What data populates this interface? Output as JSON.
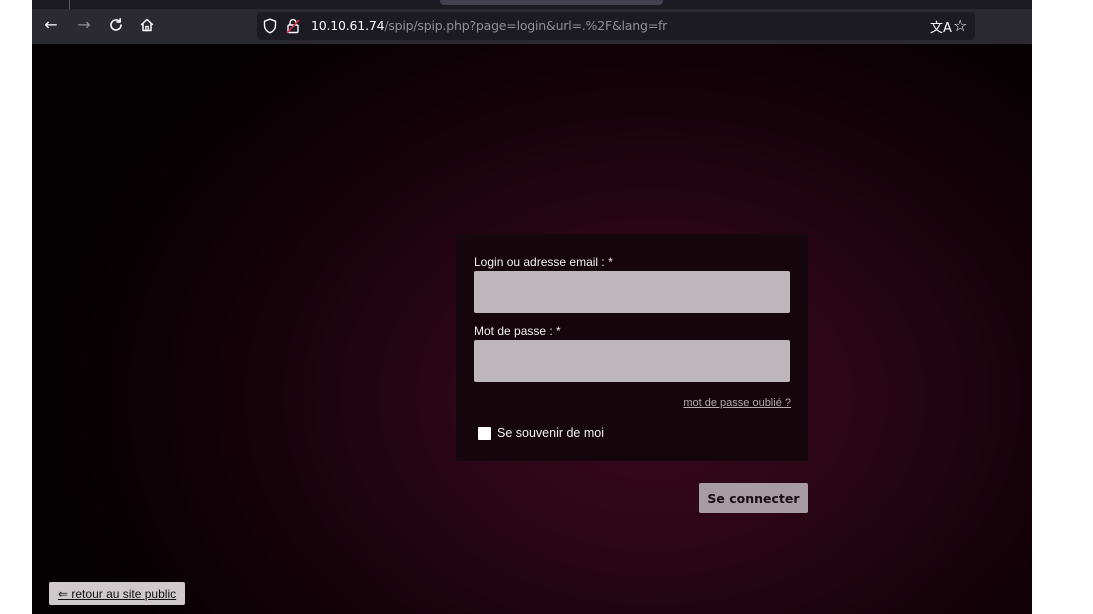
{
  "browser": {
    "back_icon": "←",
    "forward_icon": "→",
    "reload_icon": "C",
    "home_icon": "⌂",
    "url_host": "10.10.61.74",
    "url_path": "/spip/spip.php?page=login&url=.%2F&lang=fr",
    "translate_icon": "文A",
    "bookmark_icon": "☆"
  },
  "login": {
    "login_label": "Login ou adresse email : *",
    "login_value": "",
    "password_label": "Mot de passe : *",
    "password_value": "",
    "forgot_password": "mot de passe oublié ?",
    "remember_label": "Se souvenir de moi",
    "remember_checked": false,
    "submit_label": "Se connecter"
  },
  "footer": {
    "back_link": "⇐ retour au site public"
  },
  "colors": {
    "toolbar_bg": "#2b2a33",
    "page_bg_center": "#3b0a1e",
    "input_bg": "#bdb6ba",
    "button_bg": "#a79ca1"
  }
}
